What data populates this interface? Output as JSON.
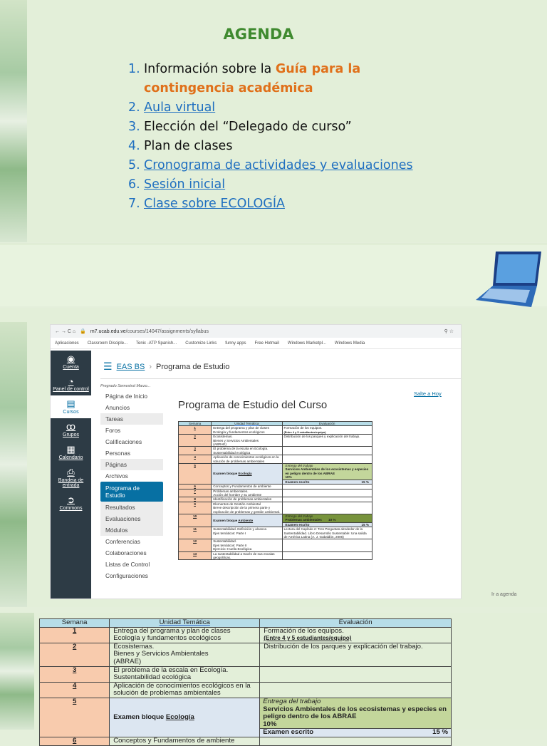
{
  "agenda": {
    "title": "AGENDA",
    "items": [
      {
        "num": "1.",
        "pre": "Información sobre la ",
        "highlight": "Guía para la contingencia académica"
      },
      {
        "num": "2.",
        "link": "Aula virtual"
      },
      {
        "num": "3.",
        "text": "Elección del “Delegado de curso”"
      },
      {
        "num": "4.",
        "text": "Plan de clases"
      },
      {
        "num": "5.",
        "link": "Cronograma de actividades y evaluaciones"
      },
      {
        "num": "6.",
        "link": "Sesión inicial"
      },
      {
        "num": "7.",
        "link": "Clase sobre ECOLOGÍA"
      }
    ]
  },
  "browser": {
    "url_host": "m7.ucab.edu.ve",
    "url_path": "/courses/14047/assignments/syllabus",
    "bookmarks": [
      "Aplicaciones",
      "Classroom Disciple...",
      "Tenic -ATP Spanish...",
      "Customize Links",
      "funny apps",
      "Free Hotmail",
      "Windows Marketpl...",
      "Windows Media"
    ],
    "global_nav": [
      {
        "icon": "◉",
        "label": "Cuenta"
      },
      {
        "icon": "◔",
        "label": "Panel de control"
      },
      {
        "icon": "▤",
        "label": "Cursos",
        "active": true
      },
      {
        "icon": "ꝏ",
        "label": "Grupos"
      },
      {
        "icon": "▦",
        "label": "Calendario"
      },
      {
        "icon": "⎙",
        "label": "Bandeja de entrada"
      },
      {
        "icon": "➲",
        "label": "Commons"
      }
    ],
    "breadcrumb": {
      "course": "EAS BS",
      "sep": "›",
      "page": "Programa de Estudio"
    },
    "term": "Pregrado Semestral Marzo...",
    "course_nav": [
      {
        "label": "Página de Inicio"
      },
      {
        "label": "Anuncios"
      },
      {
        "label": "Tareas",
        "grey": true
      },
      {
        "label": "Foros"
      },
      {
        "label": "Calificaciones"
      },
      {
        "label": "Personas"
      },
      {
        "label": "Páginas",
        "grey": true
      },
      {
        "label": "Archivos"
      },
      {
        "label": "Programa de Estudio",
        "active": true
      },
      {
        "label": "Resultados",
        "grey": true
      },
      {
        "label": "Evaluaciones",
        "grey": true
      },
      {
        "label": "Módulos",
        "grey": true
      },
      {
        "label": "Conferencias"
      },
      {
        "label": "Colaboraciones"
      },
      {
        "label": "Listas de Control"
      },
      {
        "label": "Configuraciones"
      }
    ],
    "page_title": "Programa de Estudio del Curso",
    "jump_today": "Salte a Hoy"
  },
  "goto_agenda": "Ir a agenda",
  "syllabus": {
    "headers": [
      "Semana",
      "Unidad  Temática",
      "Evaluación"
    ],
    "rows": [
      {
        "week": "1",
        "unit": "Entrega del programa y plan de clases\nEcología y fundamentos ecológicos",
        "eval": "Formación de los equipos.",
        "eval_bold": "(Entre 4 y 5 estudiantes/equipo)"
      },
      {
        "week": "2",
        "unit": "Ecosistemas.\nBienes y Servicios Ambientales\n(ABRAE)",
        "eval": "Distribución de los parques y explicación del trabajo."
      },
      {
        "week": "3",
        "unit": "El problema de la escala en Ecología.\nSustentabilidad ecológica",
        "eval": ""
      },
      {
        "week": "4",
        "unit": "Aplicación de conocimientos ecológicos en la solución de problemas ambientales",
        "eval": ""
      },
      {
        "week": "5",
        "exam_pre": "Examen bloque ",
        "exam_topic": "Ecología",
        "delivery": {
          "label": "Entrega del trabajo",
          "text": "Servicios Ambientales de los ecosistemas y especies en peligro dentro de los ABRAE",
          "pct": "10%",
          "dark": false
        },
        "exam_label": "Examen escrito",
        "exam_pct": "15 %"
      },
      {
        "week": "6",
        "unit": "Conceptos y Fundamentos de ambiente",
        "eval": ""
      },
      {
        "week": "7",
        "unit": "Problemas ambientales.\nAcción del hombre y su ambiente",
        "eval": ""
      },
      {
        "week": "8",
        "unit": "Identificación de problemas ambientales",
        "eval": ""
      },
      {
        "week": "9",
        "unit": "Elementos de Gestión Ambiental\nBreve descripción de la primera parte y explicación de problemas y gestión ambiental.",
        "eval": ""
      },
      {
        "week": "10",
        "exam_pre": "Examen bloque ",
        "exam_topic": "Ambiente",
        "delivery": {
          "label": "Entrega del trabajo",
          "text": "Problemas ambientales",
          "pct": "10 %",
          "dark": true
        },
        "exam_label": "Examen escrito",
        "exam_pct": "15 %"
      },
      {
        "week": "11",
        "unit": "Sustentabilidad. Definición y alcance.\nEjes temáticos: Parte I",
        "eval": "Lectura del Capítulo 2: Tres Preguntas alrededor de la Sustentabilidad. Libro Desarrollo Sustentable: Una salida de América Latina (A. J. Gabaldón, 2006)"
      },
      {
        "week": "12",
        "unit": "Sustentabilidad.\nEjes temáticos: Parte II\nEjercicio: Huella Ecológica",
        "eval": ""
      },
      {
        "week": "13",
        "unit": "La sustentabilidad a través de sus escalas geográficas.",
        "eval": ""
      }
    ]
  },
  "colors": {
    "title_green": "#3f8a2f",
    "link_blue": "#1f6fc0",
    "highlight_orange": "#e0701a",
    "canvas_nav": "#2d3b45",
    "canvas_blue": "#0770a3"
  }
}
